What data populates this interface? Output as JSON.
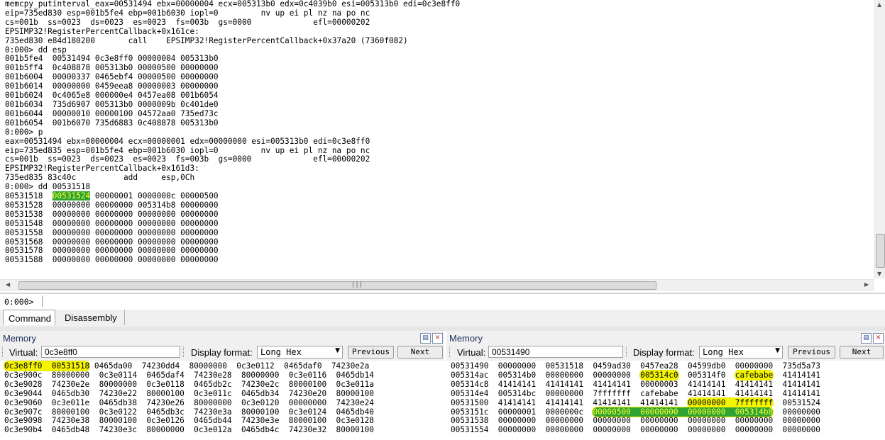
{
  "command_output": {
    "lines_pre_a": [
      "memcpy_putinterval_eax=00531494 ebx=00000004 ecx=005313b0 edx=0c4039b0 esi=005313b0 edi=0c3e8ff0",
      "eip=735ed830 esp=001b5fe4 ebp=001b6030 iopl=0         nv up ei pl nz na po nc",
      "cs=001b  ss=0023  ds=0023  es=0023  fs=003b  gs=0000             efl=00000202",
      "EPSIMP32!RegisterPercentCallback+0x161ce:",
      "735ed830 e84d180200       call    EPSIMP32!RegisterPercentCallback+0x37a20 (7360f082)",
      "0:000> dd esp",
      "001b5fe4  00531494 0c3e8ff0 00000004 005313b0",
      "001b5ff4  0c408878 005313b0 00000500 00000000",
      "001b6004  00000337 0465ebf4 00000500 00000000",
      "001b6014  00000000 0459eea8 00000003 00000000",
      "001b6024  0c4065e8 000000e4 0457ea08 001b6054",
      "001b6034  735d6907 005313b0 0000009b 0c401de0",
      "001b6044  00000010 00000100 04572aa0 735ed73c",
      "001b6054  001b6070 735d6883 0c408878 005313b0",
      "0:000> p",
      "eax=00531494 ebx=00000004 ecx=00000001 edx=00000000 esi=005313b0 edi=0c3e8ff0",
      "eip=735ed835 esp=001b5fe4 ebp=001b6030 iopl=0         nv up ei pl nz na po nc",
      "cs=001b  ss=0023  ds=0023  es=0023  fs=003b  gs=0000             efl=00000202",
      "EPSIMP32!RegisterPercentCallback+0x161d3:",
      "735ed835 83c40c          add     esp,0Ch",
      "0:000> dd 00531518"
    ],
    "hl_line": {
      "addr": "00531518  ",
      "highlight": "00531524",
      "rest": " 00000001 0000000c 00000500"
    },
    "lines_pre_b": [
      "00531528  00000000 00000000 005314b8 00000000",
      "00531538  00000000 00000000 00000000 00000000",
      "00531548  00000000 00000000 00000000 00000000",
      "00531558  00000000 00000000 00000000 00000000",
      "00531568  00000000 00000000 00000000 00000000",
      "00531578  00000000 00000000 00000000 00000000",
      "00531588  00000000 00000000 00000000 00000000"
    ]
  },
  "prompt": {
    "label": "0:000>",
    "value": ""
  },
  "tabs": [
    {
      "label": "Command",
      "active": true
    },
    {
      "label": "Disassembly",
      "active": false
    }
  ],
  "memory_left": {
    "title": "Memory",
    "virtual_label": "Virtual:",
    "virtual_value": "0c3e8ff0",
    "display_format_label": "Display format:",
    "display_format_value": "Long Hex",
    "previous_label": "Previous",
    "next_label": "Next",
    "first_highlight": "0c3e8ff0  00531518",
    "first_rest": " 0465da00  74230dd4  80000000  0c3e0112  0465daf0  74230e2a",
    "rows": [
      "0c3e900c  80000000  0c3e0114  0465daf4  74230e28  80000000  0c3e0116  0465db14",
      "0c3e9028  74230e2e  80000000  0c3e0118  0465db2c  74230e2c  80000100  0c3e011a",
      "0c3e9044  0465db30  74230e22  80000100  0c3e011c  0465db34  74230e20  80000100",
      "0c3e9060  0c3e011e  0465db38  74230e26  80000000  0c3e0120  00000000  74230e24",
      "0c3e907c  80000100  0c3e0122  0465db3c  74230e3a  80000100  0c3e0124  0465db40",
      "0c3e9098  74230e38  80000100  0c3e0126  0465db44  74230e3e  80000100  0c3e0128",
      "0c3e90b4  0465db48  74230e3c  80000000  0c3e012a  0465db4c  74230e32  80000100"
    ]
  },
  "memory_right": {
    "title": "Memory",
    "virtual_label": "Virtual:",
    "virtual_value": "00531490",
    "display_format_label": "Display format:",
    "display_format_value": "Long Hex",
    "previous_label": "Previous",
    "next_label": "Next",
    "row1": "00531490  00000000  00531518  0459ad30  0457ea28  04599db0  00000000  735d5a73",
    "row2": {
      "a": "005314ac  005314b0  00000000  00000000  ",
      "h1": "005314c0",
      "b": "  005314f0  ",
      "h2": "cafebabe",
      "c": "  41414141"
    },
    "row3": "005314c8  41414141  41414141  41414141  00000003  41414141  41414141  41414141",
    "row4": "005314e4  005314bc  00000000  7fffffff  cafebabe  41414141  41414141  41414141",
    "row5": {
      "a": "00531500  41414141  41414141  41414141  41414141  ",
      "h": "00000000  7fffffff",
      "b": "  00531524"
    },
    "row6": {
      "a": "0053151c  00000001  0000000c  ",
      "h": "00000500  00000000  00000000  005314b8",
      "b": "  00000000"
    },
    "row7": "00531538  00000000  00000000  00000000  00000000  00000000  00000000  00000000",
    "row8": "00531554  00000000  00000000  00000000  00000000  00000000  00000000  00000000"
  }
}
